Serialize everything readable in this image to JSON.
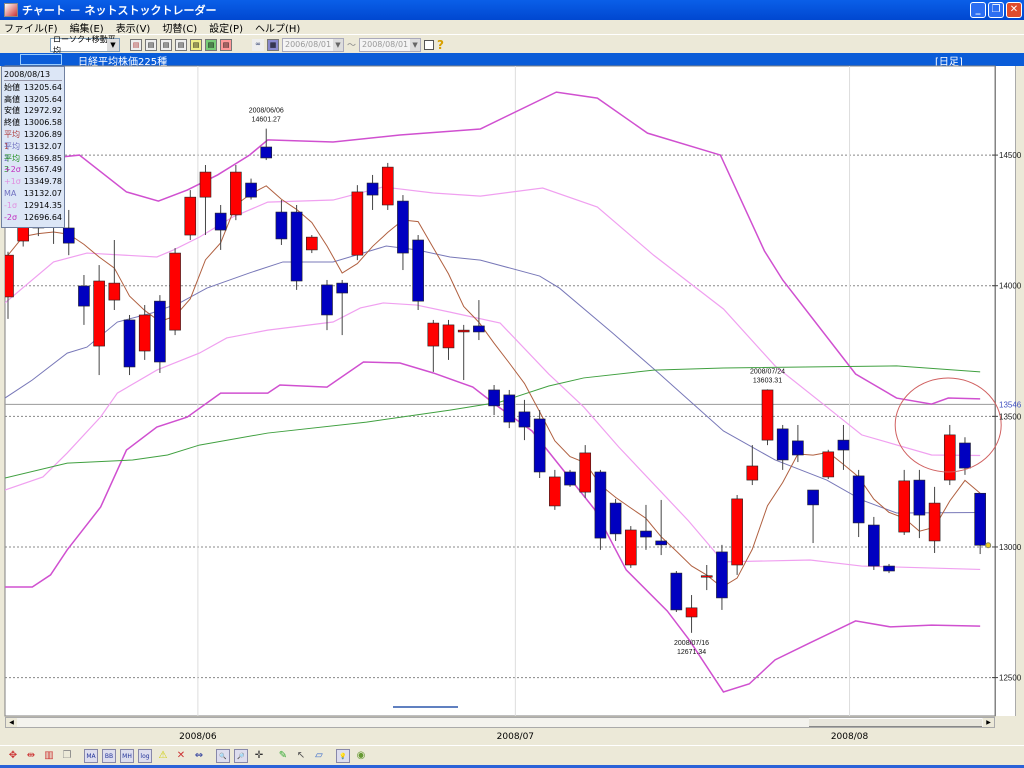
{
  "window": {
    "title": "チャート － ネットストックトレーダー",
    "buttons": [
      "_",
      "❐",
      "✕"
    ]
  },
  "menu": [
    "ファイル(F)",
    "編集(E)",
    "表示(V)",
    "切替(C)",
    "設定(P)",
    "ヘルプ(H)"
  ],
  "toolbar": {
    "chart_type": "ローソク+移動平均",
    "icons": [
      "chart-icon-1",
      "chart-icon-2",
      "chart-icon-3",
      "chart-icon-4",
      "chart-icon-5",
      "chart-icon-6",
      "chart-icon-7",
      "link-icon",
      "calendar-icon"
    ],
    "date_from": "2006/08/01",
    "tilde": "～",
    "date_to": "2008/08/01",
    "help": "?"
  },
  "header": {
    "title": "日経平均株価225種",
    "timeframe": "[日足]"
  },
  "info": {
    "date": "2008/08/13",
    "rows": [
      {
        "label": "始値",
        "value": "13205.64",
        "color": "#000000"
      },
      {
        "label": "高値",
        "value": "13205.64",
        "color": "#000000"
      },
      {
        "label": "安値",
        "value": "12972.92",
        "color": "#000000"
      },
      {
        "label": "終値",
        "value": "13006.58",
        "color": "#000000"
      },
      {
        "label": "平均1",
        "value": "13206.89",
        "color": "#b04040"
      },
      {
        "label": "平均2",
        "value": "13132.07",
        "color": "#7070c0"
      },
      {
        "label": "平均3",
        "value": "13669.85",
        "color": "#209020"
      },
      {
        "label": "+2σ",
        "value": "13567.49",
        "color": "#c030c0"
      },
      {
        "label": "+1σ",
        "value": "13349.78",
        "color": "#e090e0"
      },
      {
        "label": "MA",
        "value": "13132.07",
        "color": "#7070c0"
      },
      {
        "label": "-1σ",
        "value": "12914.35",
        "color": "#e090e0"
      },
      {
        "label": "-2σ",
        "value": "12696.64",
        "color": "#c030c0"
      }
    ]
  },
  "colors": {
    "up": "#ff0000",
    "down": "#0000c0",
    "ma1": "#b06040",
    "ma": "#7878b8",
    "ma3": "#40a040",
    "sigma2": "#d050d0",
    "sigma1": "#f0a0f0",
    "circle": "#d06060"
  },
  "chart_data": {
    "type": "candlestick",
    "title": "日経平均株価225種",
    "ylim": [
      12353,
      14841
    ],
    "yticks": [
      12500,
      13000,
      13500,
      14000,
      14500
    ],
    "ytick_labels": [
      "12500",
      "13000",
      "13500",
      "14000",
      "14500"
    ],
    "reference_line": {
      "value": 13546,
      "label": "13546"
    },
    "xtick_labels": [
      {
        "index": 12.5,
        "label": "2008/06"
      },
      {
        "index": 33.4,
        "label": "2008/07"
      },
      {
        "index": 55.4,
        "label": "2008/08"
      }
    ],
    "candles": [
      [
        13957,
        14130,
        13873,
        14117
      ],
      [
        14171,
        14290,
        14150,
        14260
      ],
      [
        14280,
        14300,
        14190,
        14221
      ],
      [
        14240,
        14260,
        14160,
        14225
      ],
      [
        14221,
        14290,
        14117,
        14163
      ],
      [
        13999,
        14041,
        13850,
        13922
      ],
      [
        13769,
        14079,
        13658,
        14018
      ],
      [
        13945,
        14175,
        13907,
        14010
      ],
      [
        13869,
        13888,
        13658,
        13689
      ],
      [
        13750,
        13926,
        13716,
        13888
      ],
      [
        13941,
        13964,
        13666,
        13708
      ],
      [
        13830,
        14144,
        13811,
        14125
      ],
      [
        14194,
        14366,
        14175,
        14339
      ],
      [
        14339,
        14462,
        14194,
        14435
      ],
      [
        14278,
        14309,
        14137,
        14213
      ],
      [
        14271,
        14462,
        14251,
        14435
      ],
      [
        14393,
        14410,
        14330,
        14339
      ],
      [
        14531,
        14601.27,
        14481,
        14489
      ],
      [
        14282,
        14328,
        14156,
        14179
      ],
      [
        14282,
        14309,
        13984,
        14018
      ],
      [
        14137,
        14194,
        14125,
        14186
      ],
      [
        14003,
        14022,
        13830,
        13888
      ],
      [
        14010,
        14022,
        13811,
        13972
      ],
      [
        14117,
        14385,
        14098,
        14359
      ],
      [
        14393,
        14424,
        14290,
        14347
      ],
      [
        14309,
        14470,
        14290,
        14454
      ],
      [
        14324,
        14347,
        14060,
        14125
      ],
      [
        14175,
        14194,
        13907,
        13941
      ],
      [
        13769,
        13869,
        13670,
        13857
      ],
      [
        13762,
        13869,
        13716,
        13850
      ],
      [
        13823,
        13850,
        13639,
        13830
      ],
      [
        13846,
        13945,
        13792,
        13823
      ],
      [
        13601,
        13620,
        13505,
        13540
      ],
      [
        13582,
        13601,
        13455,
        13478
      ],
      [
        13517,
        13563,
        13409,
        13459
      ],
      [
        13490,
        13524,
        13264,
        13287
      ],
      [
        13157,
        13295,
        13142,
        13268
      ],
      [
        13287,
        13295,
        13230,
        13237
      ],
      [
        13210,
        13390,
        13188,
        13360
      ],
      [
        13287,
        13295,
        12989,
        13034
      ],
      [
        13168,
        13184,
        13023,
        13050
      ],
      [
        12931,
        13080,
        12920,
        13065
      ],
      [
        13061,
        13161,
        12989,
        13038
      ],
      [
        13023,
        13180,
        12969,
        13008
      ],
      [
        12900,
        12908,
        12751,
        12759
      ],
      [
        12732,
        12816,
        12671.34,
        12767
      ],
      [
        12885,
        12931,
        12835,
        12890
      ],
      [
        12981,
        13008,
        12759,
        12805
      ],
      [
        12931,
        13199,
        12893,
        13184
      ],
      [
        13256,
        13390,
        13237,
        13310
      ],
      [
        13409,
        13603.31,
        13390,
        13601
      ],
      [
        13452,
        13467,
        13295,
        13333
      ],
      [
        13406,
        13467,
        13325,
        13352
      ],
      [
        13218,
        13218,
        13015,
        13161
      ],
      [
        13268,
        13372,
        13260,
        13364
      ],
      [
        13409,
        13467,
        13295,
        13371
      ],
      [
        13272,
        13295,
        13038,
        13092
      ],
      [
        13084,
        13115,
        12912,
        12927
      ],
      [
        12927,
        12935,
        12900,
        12908
      ],
      [
        13057,
        13295,
        13046,
        13253
      ],
      [
        13256,
        13295,
        13034,
        13122
      ],
      [
        13023,
        13230,
        12977,
        13168
      ],
      [
        13256,
        13467,
        13237,
        13429
      ],
      [
        13398,
        13420,
        13276,
        13302
      ],
      [
        13205.64,
        13205.64,
        12972.92,
        13006.58
      ]
    ],
    "ma1_period": 5,
    "lines": {
      "sigma_plus2": [
        [
          -0.5,
          14462
        ],
        [
          3.6,
          14493
        ],
        [
          4.7,
          14500
        ],
        [
          7.8,
          14359
        ],
        [
          9.9,
          14324
        ],
        [
          11.8,
          14366
        ],
        [
          13.8,
          14424
        ],
        [
          15.9,
          14500
        ],
        [
          17.1,
          14558
        ],
        [
          21.4,
          14550
        ],
        [
          25.8,
          14577
        ],
        [
          31.1,
          14600
        ],
        [
          36.1,
          14741
        ],
        [
          38.8,
          14718
        ],
        [
          42.1,
          14584
        ],
        [
          46.9,
          14500
        ],
        [
          49.8,
          14133
        ],
        [
          51,
          14022
        ],
        [
          55.8,
          13662
        ],
        [
          58.5,
          13570
        ],
        [
          60.8,
          13547
        ],
        [
          61.9,
          13570
        ],
        [
          64,
          13567
        ]
      ],
      "sigma_plus1": [
        [
          -0.2,
          13934
        ],
        [
          3,
          14091
        ],
        [
          5.2,
          14125
        ],
        [
          9.8,
          14110
        ],
        [
          10.9,
          14137
        ],
        [
          12.6,
          14186
        ],
        [
          14.8,
          14263
        ],
        [
          17.1,
          14320
        ],
        [
          21.4,
          14328
        ],
        [
          24.7,
          14378
        ],
        [
          28,
          14355
        ],
        [
          31.1,
          14343
        ],
        [
          35.2,
          14374
        ],
        [
          38.8,
          14301
        ],
        [
          42.5,
          14117
        ],
        [
          47.1,
          13911
        ],
        [
          50.5,
          13693
        ],
        [
          53.9,
          13536
        ],
        [
          56.2,
          13429
        ],
        [
          60.8,
          13352
        ],
        [
          64,
          13350
        ]
      ],
      "ma": [
        [
          -0.2,
          13570
        ],
        [
          1.6,
          13639
        ],
        [
          3.9,
          13742
        ],
        [
          5.2,
          13765
        ],
        [
          7.2,
          13861
        ],
        [
          9.5,
          13896
        ],
        [
          11.3,
          13934
        ],
        [
          13.1,
          13991
        ],
        [
          15.9,
          14049
        ],
        [
          18.1,
          14091
        ],
        [
          21.4,
          14091
        ],
        [
          23.6,
          14129
        ],
        [
          24.9,
          14152
        ],
        [
          26.9,
          14137
        ],
        [
          29.1,
          14110
        ],
        [
          31.1,
          14098
        ],
        [
          35,
          14037
        ],
        [
          36.3,
          13991
        ],
        [
          39.8,
          13819
        ],
        [
          42.9,
          13662
        ],
        [
          47.1,
          13444
        ],
        [
          50.5,
          13333
        ],
        [
          53.9,
          13256
        ],
        [
          56.2,
          13180
        ],
        [
          58.5,
          13130
        ],
        [
          64,
          13132
        ]
      ],
      "sigma_minus1": [
        [
          -0.2,
          13218
        ],
        [
          2.3,
          13268
        ],
        [
          3.9,
          13360
        ],
        [
          6.1,
          13498
        ],
        [
          7.2,
          13589
        ],
        [
          9.8,
          13677
        ],
        [
          12.6,
          13742
        ],
        [
          14.4,
          13800
        ],
        [
          17.1,
          13830
        ],
        [
          21.4,
          13861
        ],
        [
          23.2,
          13915
        ],
        [
          24.7,
          13934
        ],
        [
          26.9,
          13926
        ],
        [
          29.1,
          13899
        ],
        [
          32.4,
          13857
        ],
        [
          35.6,
          13662
        ],
        [
          37.9,
          13536
        ],
        [
          40.2,
          13383
        ],
        [
          44.8,
          13100
        ],
        [
          47.1,
          12943
        ],
        [
          52.8,
          12950
        ],
        [
          56.2,
          12927
        ],
        [
          64,
          12914
        ]
      ],
      "sigma_minus2": [
        [
          -0.2,
          12847
        ],
        [
          1.6,
          12847
        ],
        [
          2.8,
          12893
        ],
        [
          3.9,
          12989
        ],
        [
          6.1,
          13153
        ],
        [
          7.8,
          13371
        ],
        [
          9.8,
          13459
        ],
        [
          11.8,
          13497
        ],
        [
          14,
          13589
        ],
        [
          17.1,
          13589
        ],
        [
          17.9,
          13620
        ],
        [
          21,
          13612
        ],
        [
          23.4,
          13708
        ],
        [
          25.8,
          13704
        ],
        [
          28,
          13666
        ],
        [
          30.6,
          13612
        ],
        [
          32.2,
          13540
        ],
        [
          34.5,
          13444
        ],
        [
          38.6,
          13145
        ],
        [
          40.7,
          12912
        ],
        [
          43.4,
          12755
        ],
        [
          44.8,
          12648
        ],
        [
          47.1,
          12445
        ],
        [
          48.8,
          12476
        ],
        [
          50.5,
          12568
        ],
        [
          52.8,
          12633
        ],
        [
          55.8,
          12717
        ],
        [
          58.1,
          12694
        ],
        [
          60.8,
          12701
        ],
        [
          64,
          12697
        ]
      ],
      "ma3": [
        [
          -0.2,
          13264
        ],
        [
          3.9,
          13321
        ],
        [
          8.2,
          13333
        ],
        [
          10.5,
          13352
        ],
        [
          12.6,
          13390
        ],
        [
          17.1,
          13436
        ],
        [
          23.6,
          13478
        ],
        [
          29.1,
          13524
        ],
        [
          32.4,
          13555
        ],
        [
          35.6,
          13616
        ],
        [
          37.9,
          13647
        ],
        [
          42.5,
          13677
        ],
        [
          47.1,
          13685
        ],
        [
          58.5,
          13693
        ],
        [
          64,
          13670
        ]
      ]
    },
    "annotations": [
      {
        "index": 17,
        "date": "2008/06/06",
        "value": "14601.27",
        "position": "above"
      },
      {
        "index": 45,
        "date": "2008/07/16",
        "value": "12671.34",
        "position": "below"
      },
      {
        "index": 50,
        "date": "2008/07/24",
        "value": "13603.31",
        "position": "above"
      }
    ],
    "highlight_circle_indices": [
      59,
      64
    ]
  },
  "bottom_toolbar": [
    "move-icon",
    "expand-icon",
    "bars-icon",
    "copy-icon",
    "ma-icon",
    "bb-icon",
    "mh-icon",
    "log-icon",
    "warning-icon",
    "crosshair-icon",
    "split-icon",
    "zoom-in-icon",
    "zoom-out-icon",
    "cross-icon",
    "pen-icon",
    "pointer-icon",
    "eraser-icon",
    "bulb-icon",
    "paint-icon"
  ],
  "bottom_glyphs": [
    "✥",
    "⇹",
    "▥",
    "❐",
    "MA",
    "BB",
    "MH",
    "log",
    "⚠",
    "✕",
    "⇔",
    "🔍",
    "🔎",
    "✛",
    "✎",
    "↖",
    "▱",
    "💡",
    "◉"
  ]
}
